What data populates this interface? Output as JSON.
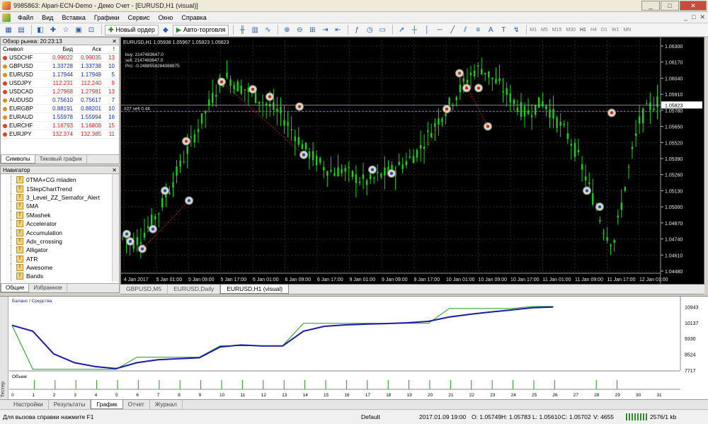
{
  "window": {
    "title": "9985863: Alpari-ECN-Demo - Демо Счет - [EURUSD,H1 (visual)]",
    "min": "_",
    "max": "□",
    "close": "✕"
  },
  "menu": [
    "Файл",
    "Вид",
    "Вставка",
    "Графики",
    "Сервис",
    "Окно",
    "Справка"
  ],
  "menu_right": [
    "_",
    "□",
    "✕"
  ],
  "toolbar": {
    "new_order": "Новый ордер",
    "autotrading": "Авто-торговля",
    "timeframes": [
      "M1",
      "M5",
      "M15",
      "M30",
      "H1",
      "H4",
      "D1",
      "W1",
      "MN"
    ],
    "active_timeframe": "H1"
  },
  "market_watch": {
    "title": "Обзор рынка: 20:23:13",
    "headers": [
      "Символ",
      "Бид",
      "Аск",
      "!"
    ],
    "rows": [
      {
        "symbol": "USDCHF",
        "bid": "0.99022",
        "ask": "0.99035",
        "spread": "13",
        "color": "red"
      },
      {
        "symbol": "GBPUSD",
        "bid": "1.33728",
        "ask": "1.33738",
        "spread": "10",
        "color": "blue"
      },
      {
        "symbol": "EURUSD",
        "bid": "1.17944",
        "ask": "1.17949",
        "spread": "5",
        "color": "blue"
      },
      {
        "symbol": "USDJPY",
        "bid": "112.231",
        "ask": "112.240",
        "spread": "9",
        "color": "red"
      },
      {
        "symbol": "USDCAD",
        "bid": "1.27968",
        "ask": "1.27981",
        "spread": "13",
        "color": "red"
      },
      {
        "symbol": "AUDUSD",
        "bid": "0.75610",
        "ask": "0.75617",
        "spread": "7",
        "color": "blue"
      },
      {
        "symbol": "EURGBP",
        "bid": "0.88191",
        "ask": "0.88201",
        "spread": "10",
        "color": "blue"
      },
      {
        "symbol": "EURAUD",
        "bid": "1.55978",
        "ask": "1.55994",
        "spread": "16",
        "color": "blue"
      },
      {
        "symbol": "EURCHF",
        "bid": "1.16793",
        "ask": "1.16808",
        "spread": "15",
        "color": "red"
      },
      {
        "symbol": "EURJPY",
        "bid": "132.374",
        "ask": "132.385",
        "spread": "11",
        "color": "red"
      }
    ],
    "tabs": [
      "Символы",
      "Тиковый график"
    ]
  },
  "navigator": {
    "title": "Навигатор",
    "items": [
      "0TMA+CG mladen",
      "1StepChartTrend",
      "3_Level_ZZ_Semafor_Alert",
      "5MA",
      "5Mashek",
      "Accelerator",
      "Accumulation",
      "Adx_crossing",
      "Alligator",
      "ATR",
      "Awesome",
      "Bands"
    ],
    "tabs": [
      "Общие",
      "Избранное"
    ]
  },
  "chart": {
    "header": "EURUSD,H1  1.05938 1.05967 1.05823 1.05823",
    "info": [
      "buy: 2147483647.0",
      "sell: 2147483647.0",
      "Pro: -0.2488558284088875"
    ],
    "order_label": "#27 sell 0.44",
    "price_ticks": [
      "1.06300",
      "1.06170",
      "1.06040",
      "1.05910",
      "1.05780",
      "1.05650",
      "1.05520",
      "1.05390",
      "1.05260",
      "1.05130",
      "1.05000",
      "1.04870",
      "1.04740",
      "1.04610",
      "1.04480"
    ],
    "current_price": "1.05823",
    "time_ticks": [
      "4 Jan 2017",
      "5 Jan 01:00",
      "5 Jan 09:00",
      "5 Jan 17:00",
      "6 Jan 01:00",
      "6 Jan 09:00",
      "6 Jan 17:00",
      "9 Jan 01:00",
      "9 Jan 09:00",
      "9 Jan 17:00",
      "10 Jan 01:00",
      "10 Jan 09:00",
      "10 Jan 17:00",
      "11 Jan 01:00",
      "11 Jan 09:00",
      "11 Jan 17:00",
      "12 Jan 01:00"
    ],
    "colors": {
      "bg": "#000000",
      "candle": "#19d219",
      "grid": "#3a3a3a",
      "text": "#e8e8e8"
    },
    "tabs": [
      "GBPUSD,M5",
      "EURUSD,Daily",
      "EURUSD,H1 (visual)"
    ]
  },
  "tester": {
    "side_label": "Тестер",
    "legend": "Баланс / Средства",
    "y_ticks": [
      "10943",
      "10137",
      "9330",
      "8524",
      "7717"
    ],
    "volume_label": "Объем",
    "x_ticks": [
      "0",
      "1",
      "2",
      "3",
      "4",
      "5",
      "6",
      "7",
      "8",
      "9",
      "10",
      "11",
      "12",
      "13",
      "14",
      "15",
      "16",
      "17",
      "18",
      "19",
      "20",
      "21",
      "22",
      "23",
      "24",
      "25",
      "26",
      "27",
      "28",
      "29",
      "30",
      "31"
    ],
    "tabs": [
      "Настройки",
      "Результаты",
      "График",
      "Отчет",
      "Журнал"
    ],
    "active_tab": "График",
    "chart_data": {
      "type": "line",
      "x": [
        0,
        1,
        2,
        3,
        4,
        5,
        6,
        7,
        8,
        9,
        10,
        11,
        12,
        13,
        14,
        15,
        16,
        17,
        18,
        19,
        20,
        21,
        22,
        23,
        24,
        25,
        26
      ],
      "series": [
        {
          "name": "Баланс",
          "values": [
            10000,
            7760,
            7760,
            7760,
            7760,
            7760,
            8380,
            8380,
            8380,
            8380,
            8960,
            8960,
            8960,
            8960,
            10100,
            10100,
            10100,
            10100,
            10100,
            10100,
            10100,
            10850,
            10850,
            10850,
            10850,
            10960,
            10960
          ],
          "color": "#1f9a1f"
        },
        {
          "name": "Средства",
          "values": [
            10000,
            9700,
            8550,
            8100,
            7900,
            7800,
            8100,
            8250,
            8300,
            8350,
            8900,
            9000,
            8950,
            8950,
            9700,
            9950,
            10020,
            10060,
            10090,
            10130,
            10200,
            10420,
            10560,
            10680,
            10780,
            10890,
            10930
          ],
          "color": "#1a1aa8"
        }
      ],
      "ylim": [
        7717,
        11100
      ]
    }
  },
  "status": {
    "help": "Для вызова справки нажмите F1",
    "profile": "Default",
    "datetime": "2017.01.09 19:00",
    "open": "O: 1.05749",
    "high": "H: 1.05783",
    "low": "L: 1.05610",
    "close": "C: 1.05702",
    "volume": "V: 4655",
    "traffic": "2576/1 kb"
  }
}
